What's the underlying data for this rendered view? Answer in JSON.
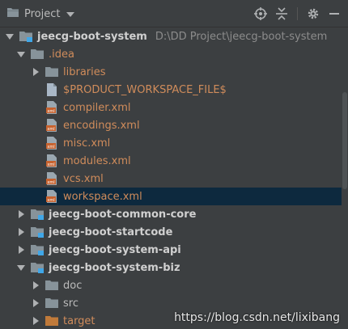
{
  "toolbar": {
    "title": "Project",
    "icons": [
      "project-view-icon",
      "chevron-down-icon",
      "locate-icon",
      "collapse-all-icon",
      "gear-icon",
      "hide-icon"
    ]
  },
  "tree": {
    "root": {
      "label": "jeecg-boot-system",
      "path": "D:\\DD Project\\jeecg-boot-system"
    },
    "idea": {
      "label": ".idea"
    },
    "libraries": {
      "label": "libraries"
    },
    "product_file": {
      "label": "$PRODUCT_WORKSPACE_FILE$"
    },
    "compiler": {
      "label": "compiler.xml"
    },
    "encodings": {
      "label": "encodings.xml"
    },
    "misc": {
      "label": "misc.xml"
    },
    "modules": {
      "label": "modules.xml"
    },
    "vcs": {
      "label": "vcs.xml"
    },
    "workspace": {
      "label": "workspace.xml"
    },
    "common_core": {
      "label": "jeecg-boot-common-core"
    },
    "startcode": {
      "label": "jeecg-boot-startcode"
    },
    "system_api": {
      "label": "jeecg-boot-system-api"
    },
    "system_biz": {
      "label": "jeecg-boot-system-biz"
    },
    "doc": {
      "label": "doc"
    },
    "src": {
      "label": "src"
    },
    "target": {
      "label": "target"
    }
  },
  "watermark": "https://blog.csdn.net/lixibang",
  "colors": {
    "background": "#3c3f41",
    "selection": "#0d293e",
    "folder": "#87939a",
    "excluded_folder": "#c07a3a",
    "module_blue": "#40a7e8",
    "xml_icon": "#c7622e",
    "orange_text": "#d08c5b"
  }
}
